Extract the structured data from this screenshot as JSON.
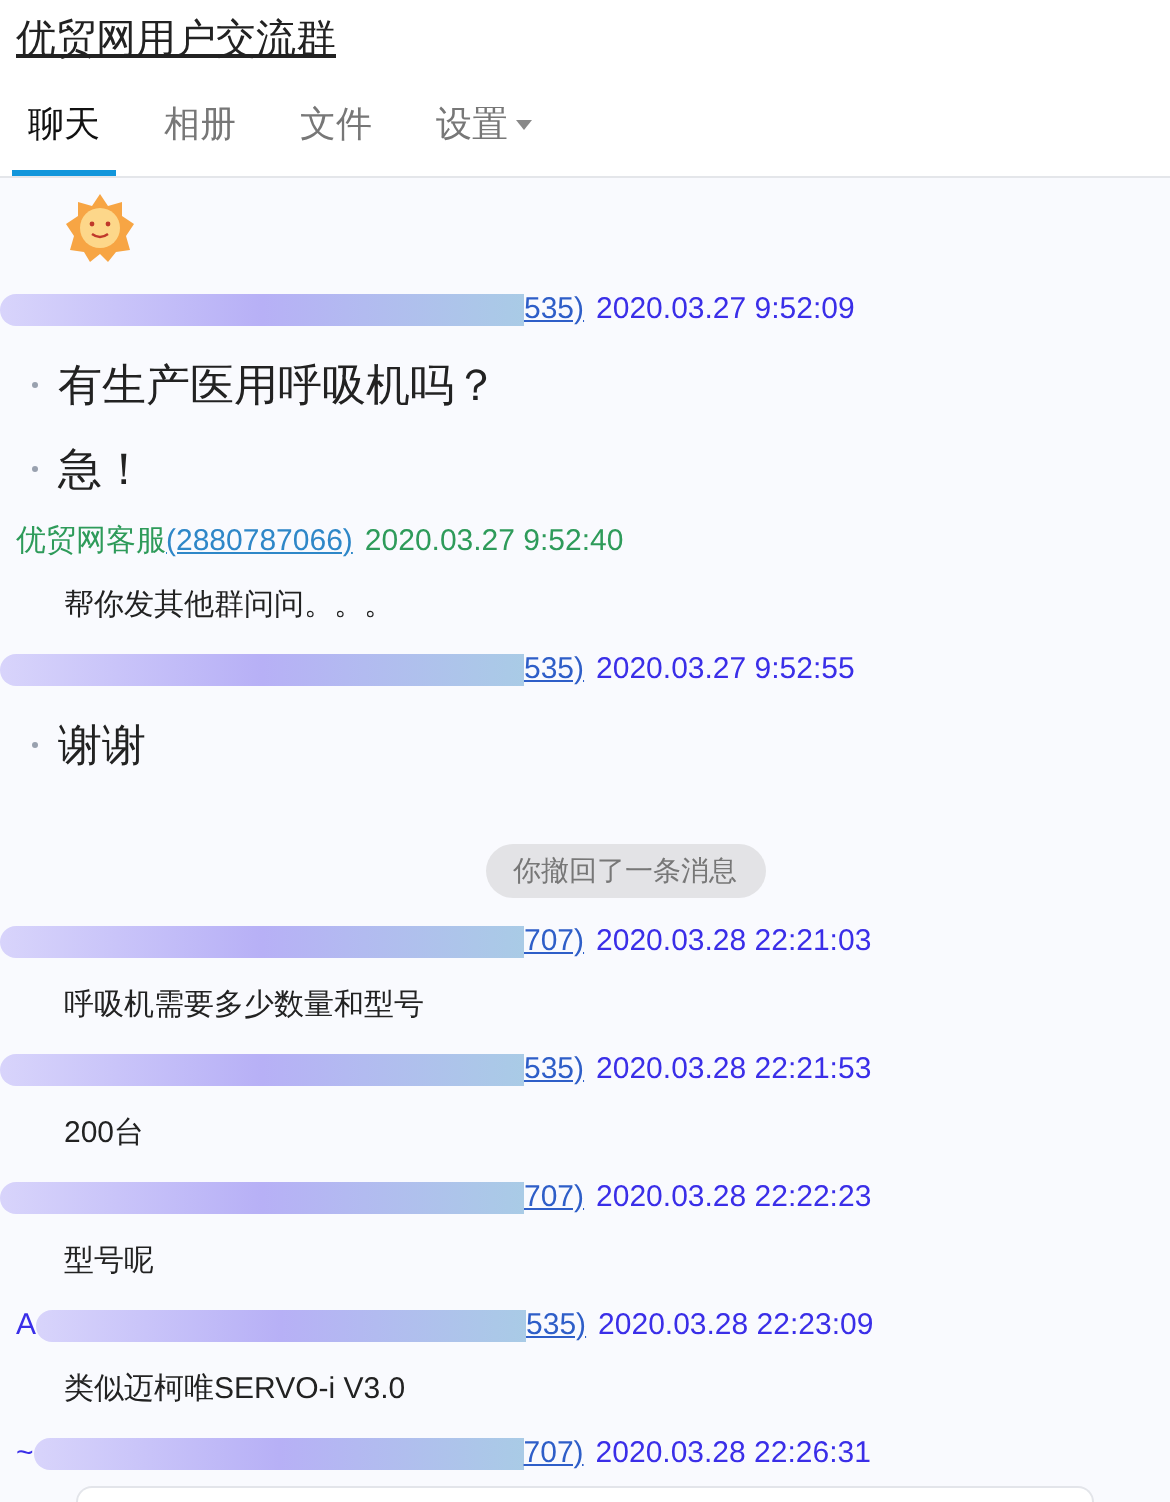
{
  "title": "优贸网用户交流群",
  "tabs": [
    {
      "label": "聊天",
      "selected": true,
      "dropdown": false
    },
    {
      "label": "相册",
      "selected": false,
      "dropdown": false
    },
    {
      "label": "文件",
      "selected": false,
      "dropdown": false
    },
    {
      "label": "设置",
      "selected": false,
      "dropdown": true
    }
  ],
  "messages": [
    {
      "kind": "emoji"
    },
    {
      "kind": "sender",
      "id": "535)",
      "time": "2020.03.27 9:52:09"
    },
    {
      "kind": "big_text",
      "text": "有生产医用呼吸机吗？"
    },
    {
      "kind": "big_text",
      "text": "急！"
    },
    {
      "kind": "service_sender",
      "name": "优贸网客服",
      "id": "(2880787066)",
      "time": "2020.03.27 9:52:40"
    },
    {
      "kind": "text",
      "text": "帮你发其他群问问。。。"
    },
    {
      "kind": "sender",
      "id": "535)",
      "time": "2020.03.27 9:52:55"
    },
    {
      "kind": "big_text",
      "text": "谢谢"
    },
    {
      "kind": "notice",
      "text": "你撤回了一条消息"
    },
    {
      "kind": "sender",
      "id": "707)",
      "time": "2020.03.28 22:21:03"
    },
    {
      "kind": "text",
      "text": "呼吸机需要多少数量和型号"
    },
    {
      "kind": "sender",
      "id": "535)",
      "time": "2020.03.28 22:21:53"
    },
    {
      "kind": "text",
      "text": "200台"
    },
    {
      "kind": "sender",
      "id": "707)",
      "time": "2020.03.28 22:22:23"
    },
    {
      "kind": "text",
      "text": "型号呢"
    },
    {
      "kind": "sender",
      "prefix": "A",
      "id": "535)",
      "time": "2020.03.28 22:23:09"
    },
    {
      "kind": "text",
      "text": "类似迈柯唯SERVO-i V3.0"
    },
    {
      "kind": "sender",
      "prefix": "~",
      "id": "707)",
      "time": "2020.03.28 22:26:31"
    }
  ]
}
